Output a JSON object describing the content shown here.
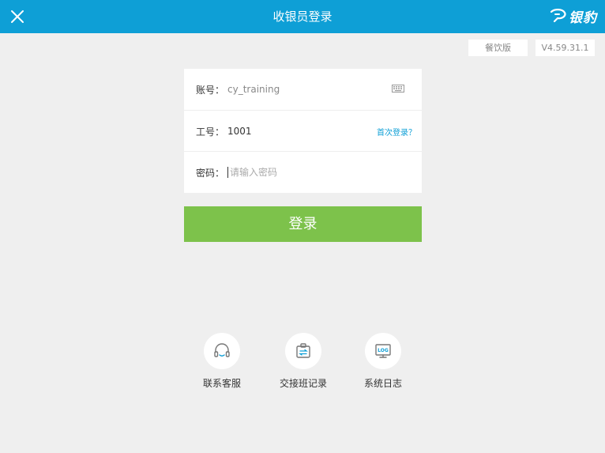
{
  "header": {
    "title": "收银员登录",
    "logo_text": "银豹",
    "close_icon": "close-icon",
    "logo_icon": "leopard-logo-icon",
    "bg_color": "#0e9fd6"
  },
  "badges": {
    "edition": "餐饮版",
    "version": "V4.59.31.1"
  },
  "form": {
    "account_label": "账号：",
    "account_value": "cy_training",
    "keyboard_icon": "keyboard-icon",
    "employee_label": "工号：",
    "employee_value": "1001",
    "first_login_link": "首次登录？",
    "password_label": "密码：",
    "password_placeholder": "请输入密码"
  },
  "login_button": {
    "label": "登录",
    "color": "#7dc24b"
  },
  "shortcuts": [
    {
      "label": "联系客服",
      "icon": "headset-icon"
    },
    {
      "label": "交接班记录",
      "icon": "shift-handover-icon"
    },
    {
      "label": "系统日志",
      "icon": "log-monitor-icon"
    }
  ]
}
